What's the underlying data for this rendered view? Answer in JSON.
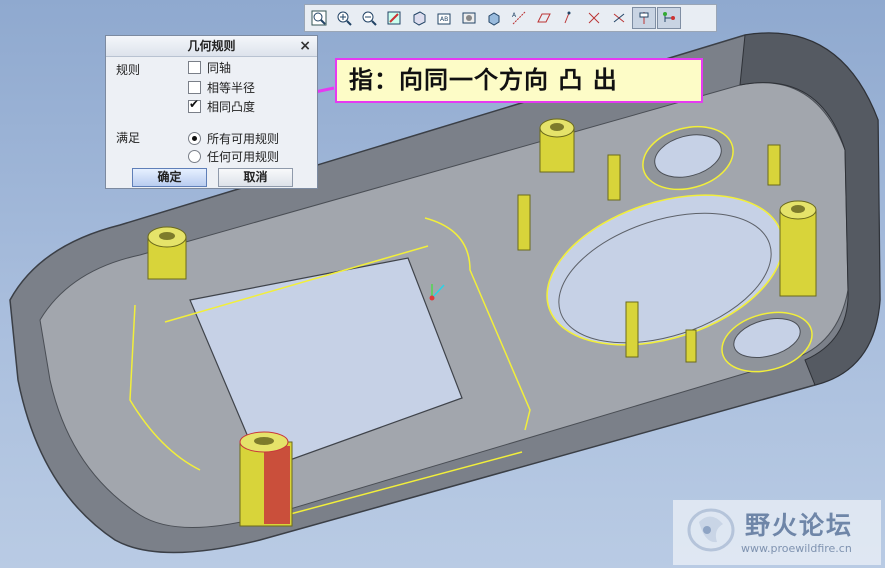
{
  "toolbar": {
    "buttons": [
      {
        "icon": "zoom-fit-icon",
        "active": false
      },
      {
        "icon": "zoom-in-icon",
        "active": false
      },
      {
        "icon": "zoom-out-icon",
        "active": false
      },
      {
        "icon": "repaint-icon",
        "active": false
      },
      {
        "icon": "shading-icon",
        "active": false
      },
      {
        "icon": "saved-views-icon",
        "active": false
      },
      {
        "icon": "layers-icon",
        "active": false
      },
      {
        "icon": "view-manager-icon",
        "active": false
      },
      {
        "icon": "datum-axes-icon",
        "active": false
      },
      {
        "icon": "datum-planes-icon",
        "active": false
      },
      {
        "icon": "datum-points-icon",
        "active": false
      },
      {
        "icon": "coordinate-systems-icon",
        "active": false
      },
      {
        "icon": "spin-center-icon",
        "active": false
      },
      {
        "icon": "annotations-icon",
        "active": true
      },
      {
        "icon": "network-icon",
        "active": true
      }
    ]
  },
  "dialog": {
    "title": "几何规则",
    "close_glyph": "×",
    "rules_label": "规则",
    "rules": [
      {
        "label": "同轴",
        "checked": false
      },
      {
        "label": "相等半径",
        "checked": false
      },
      {
        "label": "相同凸度",
        "checked": true
      }
    ],
    "satisfy_label": "满足",
    "satisfy_options": [
      {
        "label": "所有可用规则",
        "selected": true
      },
      {
        "label": "任何可用规则",
        "selected": false
      }
    ],
    "ok_label": "确定",
    "cancel_label": "取消"
  },
  "annotation": {
    "text": "指：向同一个方向  凸  出",
    "border_color": "#e53af2",
    "arrow_color": "#e53af2"
  },
  "watermark": {
    "title": "野火论坛",
    "url": "www.proewildfire.cn"
  },
  "colors": {
    "highlight": "#f2ef3a",
    "boss_fill": "#d8d43a",
    "selected_boss": "#c8373c",
    "part_body": "#8e9299"
  }
}
